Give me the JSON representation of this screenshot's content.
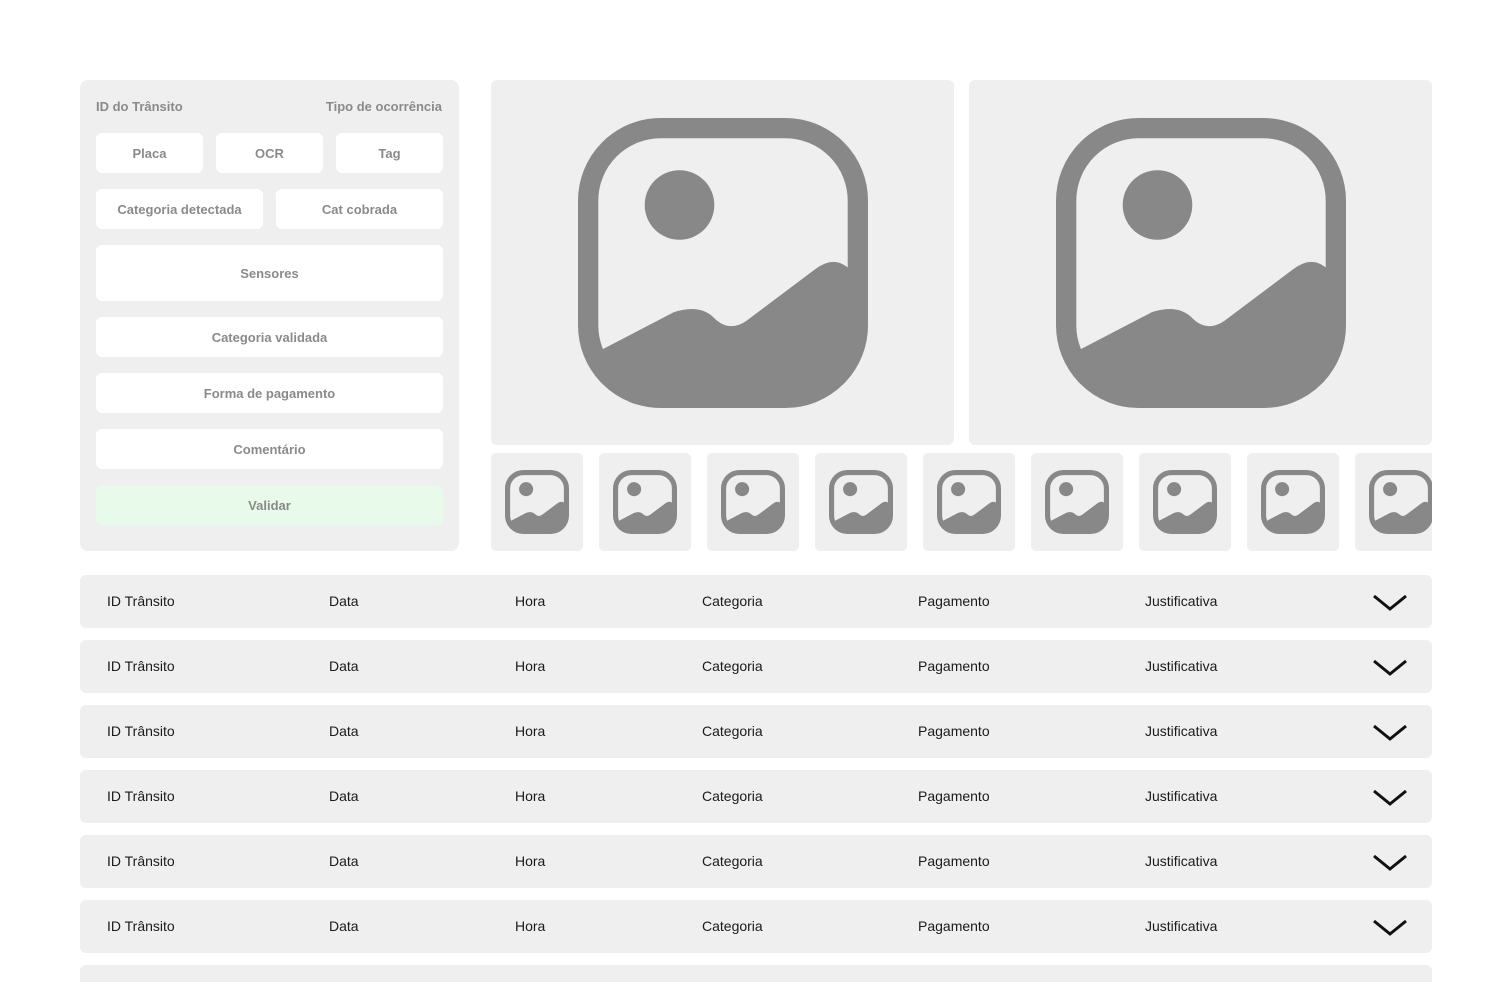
{
  "form": {
    "id_label": "ID do Trânsito",
    "tipo_label": "Tipo de ocorrência",
    "placa": "Placa",
    "ocr": "OCR",
    "tag": "Tag",
    "categoria_detectada": "Categoria detectada",
    "cat_cobrada": "Cat cobrada",
    "sensores": "Sensores",
    "categoria_validada": "Categoria validada",
    "forma_pagamento": "Forma de pagamento",
    "comentario": "Comentário",
    "validar": "Validar"
  },
  "images": {
    "main": [
      "image-placeholder-icon",
      "image-placeholder-icon"
    ],
    "thumbnail_count": 9
  },
  "table": {
    "rows": [
      {
        "id": "ID Trânsito",
        "data": "Data",
        "hora": "Hora",
        "categoria": "Categoria",
        "pagamento": "Pagamento",
        "justificativa": "Justificativa"
      },
      {
        "id": "ID Trânsito",
        "data": "Data",
        "hora": "Hora",
        "categoria": "Categoria",
        "pagamento": "Pagamento",
        "justificativa": "Justificativa"
      },
      {
        "id": "ID Trânsito",
        "data": "Data",
        "hora": "Hora",
        "categoria": "Categoria",
        "pagamento": "Pagamento",
        "justificativa": "Justificativa"
      },
      {
        "id": "ID Trânsito",
        "data": "Data",
        "hora": "Hora",
        "categoria": "Categoria",
        "pagamento": "Pagamento",
        "justificativa": "Justificativa"
      },
      {
        "id": "ID Trânsito",
        "data": "Data",
        "hora": "Hora",
        "categoria": "Categoria",
        "pagamento": "Pagamento",
        "justificativa": "Justificativa"
      },
      {
        "id": "ID Trânsito",
        "data": "Data",
        "hora": "Hora",
        "categoria": "Categoria",
        "pagamento": "Pagamento",
        "justificativa": "Justificativa"
      }
    ],
    "expand_icon": "chevron-down-icon"
  },
  "colors": {
    "panel": "#efefef",
    "icon": "#888888",
    "validate": "#e8fbea",
    "text_muted": "#8a8a8a"
  }
}
